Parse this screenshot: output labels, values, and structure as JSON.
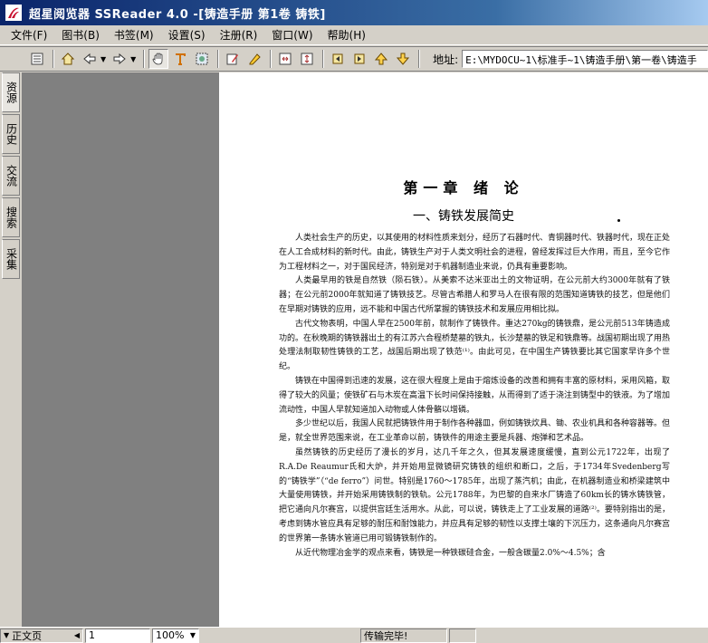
{
  "window": {
    "title": "超星阅览器 SSReader 4.0 -[铸造手册 第1卷 铸铁]"
  },
  "menu": [
    {
      "label": "文件(F)"
    },
    {
      "label": "图书(B)"
    },
    {
      "label": "书签(M)"
    },
    {
      "label": "设置(S)"
    },
    {
      "label": "注册(R)"
    },
    {
      "label": "窗口(W)"
    },
    {
      "label": "帮助(H)"
    }
  ],
  "toolbar": {
    "address_label": "地址:",
    "address_value": "E:\\MYDOCU~1\\标准手~1\\铸造手册\\第一卷\\铸造手"
  },
  "sidebar": {
    "tabs": [
      {
        "label": "资源"
      },
      {
        "label": "历史"
      },
      {
        "label": "交流"
      },
      {
        "label": "搜索"
      },
      {
        "label": "采集"
      }
    ]
  },
  "page": {
    "chapter": "第一章 绪 论",
    "section": "一、铸铁发展简史",
    "paragraphs": [
      "人类社会生产的历史，以其使用的材料性质来划分，经历了石器时代、青铜器时代、铁器时代，现在正处在人工合成材料的新时代。由此，铸铁生产对于人类文明社会的进程，曾经发挥过巨大作用，而且，至今它作为工程材料之一，对于国民经济，特别是对于机器制造业来说，仍具有重要影响。",
      "人类最早用的铁是自然铁（陨石铁）。从美索不达米亚出土的文物证明，在公元前大约3000年就有了铁器；在公元前2000年就知道了铸铁技艺。尽管古希腊人和罗马人在很有限的范围知道铸铁的技艺，但是他们在早期对铸铁的应用，远不能和中国古代所掌握的铸铁技术和发展应用相比拟。",
      "古代文物表明，中国人早在2500年前，就制作了铸铁件。重达270kg的铸铁鼎，是公元前513年铸造成功的。在秋晚期的铸铁器出土的有江苏六合程桥楚墓的铁丸，长沙楚墓的铁足和铁鼎等。战国初期出现了用热处理法制取韧性铸铁的工艺，战国后期出现了铁范⁽¹⁾。由此可见，在中国生产铸铁要比其它国家早许多个世纪。",
      "铸铁在中国得到迅速的发展，这在很大程度上是由于熔炼设备的改善和拥有丰富的原材料，采用风箱，取得了较大的风量；使铁矿石与木炭在高温下长时间保持接触，从而得到了适于浇注到铸型中的铁液。为了增加流动性，中国人早就知道加入动物或人体骨骼以增磷。",
      "多少世纪以后，我国人民就把铸铁件用于制作各种器皿，例如铸铁炊具、锄、农业机具和各种容器等。但是，就全世界范围来说，在工业革命以前，铸铁件的用途主要是兵器、炮弹和艺术品。",
      "虽然铸铁的历史经历了漫长的岁月，达几千年之久，但其发展速度缓慢，直到公元1722年，出现了R.A.De Reaumur氏和大炉，并开始用显微镜研究铸铁的组织和断口，之后，于1734年Svedenberg写的“铸铁学”（“de ferro”）问世。特别是1760～1785年，出现了蒸汽机；由此，在机器制造业和桥梁建筑中大量使用铸铁，并开始采用铸铁制的铁轨。公元1788年，为巴黎的自来水厂铸造了60km长的铸水铸铁管，把它通向凡尔赛宫，以提供宫廷生活用水。从此，可以说，铸铁走上了工业发展的道路⁽²⁾。要特别指出的是，考虑到铸水管应具有足够的耐压和耐蚀能力，并应具有足够的韧性以支撑土壤的下沉压力，这条通向凡尔赛宫的世界第一条铸水管道已用可锻铸铁制作的。",
      "从近代物理冶金学的观点来看，铸铁是一种铁碳硅合金，一般含碳量2.0%～4.5%；含"
    ]
  },
  "status": {
    "view_mode": "正文页",
    "page_number": "1",
    "zoom": "100%",
    "download_status": "传输完毕!"
  }
}
